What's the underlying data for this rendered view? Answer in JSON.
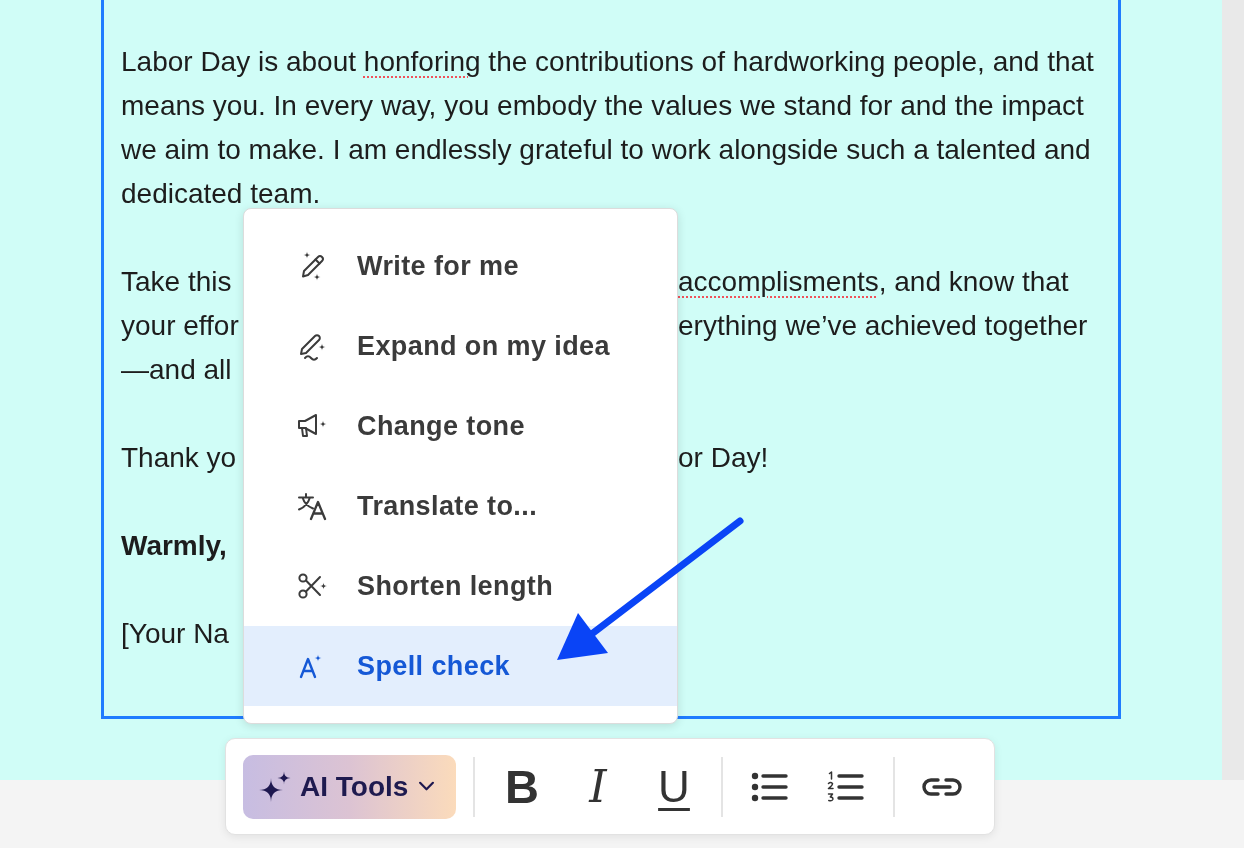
{
  "document": {
    "paragraphs": [
      {
        "kind": "text",
        "segments": [
          {
            "text": "Labor Day is about ",
            "misspelled": false
          },
          {
            "text": "honforing",
            "misspelled": true
          },
          {
            "text": " the contributions of hardworking people, and that means you. In every way, you embody the values we stand for and the impact we aim to make. I am endlessly grateful to work alongside such a talented and dedicated team.",
            "misspelled": false
          }
        ]
      },
      {
        "kind": "obscured",
        "lines": [
          {
            "left": [
              {
                "text": "Take this",
                "misspelled": false
              }
            ],
            "right": [
              {
                "text": "accomplisments",
                "misspelled": true
              },
              {
                "text": ", and know that",
                "misspelled": false
              }
            ]
          },
          {
            "left": [
              {
                "text": "your effor",
                "misspelled": false
              }
            ],
            "right": [
              {
                "text": "erything we’ve achieved together",
                "misspelled": false
              }
            ]
          },
          {
            "left": [
              {
                "text": "—and all",
                "misspelled": false
              }
            ]
          }
        ]
      },
      {
        "kind": "obscured",
        "lines": [
          {
            "left": [
              {
                "text": "Thank yo",
                "misspelled": false
              }
            ],
            "right": [
              {
                "text": "or Day!",
                "misspelled": false
              }
            ]
          }
        ]
      },
      {
        "kind": "closing",
        "segments": [
          {
            "text": "Warmly,",
            "misspelled": false
          }
        ]
      },
      {
        "kind": "obscured",
        "lines": [
          {
            "left": [
              {
                "text": "[Your Na",
                "misspelled": false
              }
            ]
          }
        ]
      }
    ]
  },
  "ai_menu": {
    "items": [
      {
        "label": "Write for me",
        "selected": false
      },
      {
        "label": "Expand on my idea",
        "selected": false
      },
      {
        "label": "Change tone",
        "selected": false
      },
      {
        "label": "Translate to...",
        "selected": false
      },
      {
        "label": "Shorten length",
        "selected": false
      },
      {
        "label": "Spell check",
        "selected": true
      }
    ]
  },
  "toolbar": {
    "ai_tools": {
      "label": "AI Tools"
    },
    "format_buttons": [
      {
        "kind": "bold",
        "label": "B"
      },
      {
        "kind": "italic",
        "label": "I"
      },
      {
        "kind": "underline",
        "label": "U"
      }
    ],
    "list_buttons": [
      {
        "kind": "bulleted"
      },
      {
        "kind": "numbered"
      }
    ],
    "insert_buttons": [
      {
        "kind": "link"
      }
    ]
  }
}
